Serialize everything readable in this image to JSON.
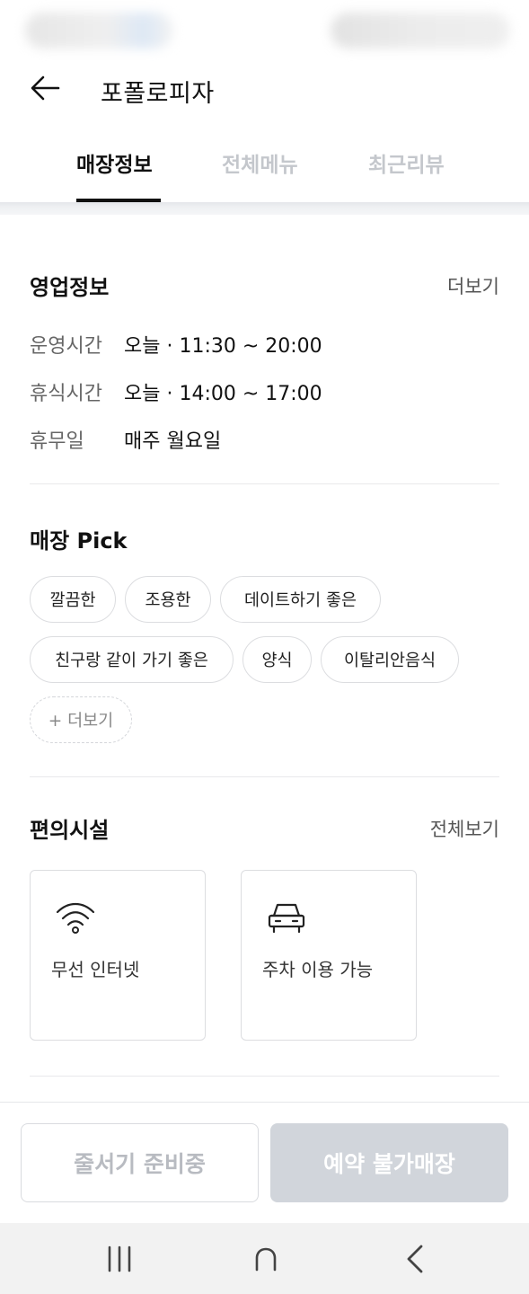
{
  "header": {
    "title": "포폴로피자"
  },
  "tabs": [
    {
      "label": "매장정보",
      "active": true
    },
    {
      "label": "전체메뉴",
      "active": false
    },
    {
      "label": "최근리뷰",
      "active": false
    }
  ],
  "business_info": {
    "title": "영업정보",
    "more_label": "더보기",
    "rows": [
      {
        "label": "운영시간",
        "value": "오늘 · 11:30 ~ 20:00"
      },
      {
        "label": "휴식시간",
        "value": "오늘 · 14:00 ~ 17:00"
      },
      {
        "label": "휴무일",
        "value": "매주 월요일"
      }
    ]
  },
  "store_pick": {
    "title": "매장 Pick",
    "tags": [
      "깔끔한",
      "조용한",
      "데이트하기 좋은",
      "친구랑 같이 가기 좋은",
      "양식",
      "이탈리안음식"
    ],
    "more_label": "+ 더보기"
  },
  "facilities": {
    "title": "편의시설",
    "more_label": "전체보기",
    "items": [
      {
        "icon": "wifi-icon",
        "label": "무선 인터넷"
      },
      {
        "icon": "car-icon",
        "label": "주차 이용 가능"
      }
    ]
  },
  "bottom_buttons": {
    "queue_label": "줄서기 준비중",
    "reserve_label": "예약 불가매장"
  },
  "colors": {
    "inactive_tab": "#c4c7cc",
    "disabled_button_bg": "#d1d5db",
    "disabled_text": "#b8bbc1"
  }
}
